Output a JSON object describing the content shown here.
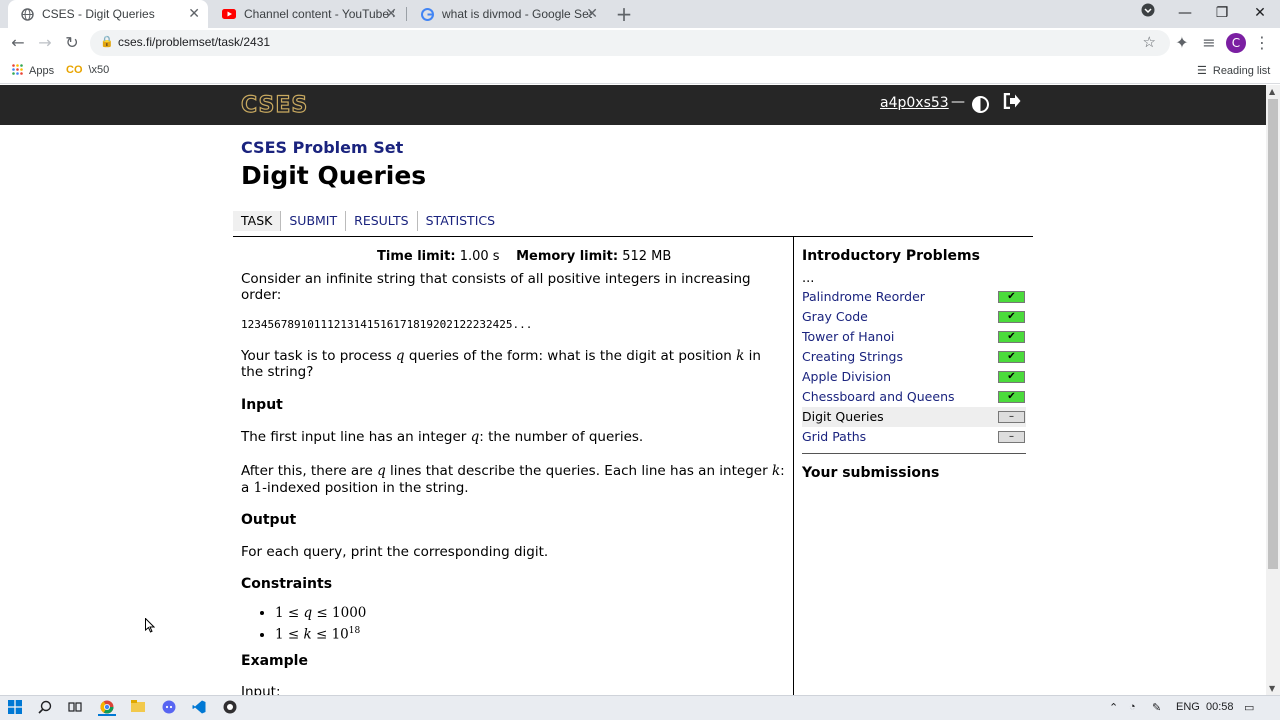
{
  "browser": {
    "tabs": [
      {
        "title": "CSES - Digit Queries",
        "icon": "cses-favicon"
      },
      {
        "title": "Channel content - YouTube Studio",
        "icon": "youtube-favicon"
      },
      {
        "title": "what is divmod - Google Search",
        "icon": "google-favicon"
      }
    ],
    "url": "cses.fi/problemset/task/2431",
    "avatar_letter": "C",
    "reading_list": "Reading list",
    "bookmarks": [
      {
        "label": "Apps",
        "icon": "apps-grid-icon"
      },
      {
        "label": "\\x50",
        "icon": "bookmark-folder-icon"
      }
    ]
  },
  "header": {
    "logo": "CSES",
    "username": "a4p0xs53",
    "dash": "—"
  },
  "site_title": "CSES Problem Set",
  "page_title": "Digit Queries",
  "nav": [
    "TASK",
    "SUBMIT",
    "RESULTS",
    "STATISTICS"
  ],
  "limits": {
    "time_label": "Time limit:",
    "time_value": "1.00 s",
    "memory_label": "Memory limit:",
    "memory_value": "512 MB"
  },
  "statement": {
    "p1": "Consider an infinite string that consists of all positive integers in increasing order:",
    "sequence": "12345678910111213141516171819202122232425...",
    "p2_a": "Your task is to process ",
    "p2_var1": "q",
    "p2_b": " queries of the form: what is the digit at position ",
    "p2_var2": "k",
    "p2_c": " in the string?",
    "input_heading": "Input",
    "input_p1_a": "The first input line has an integer ",
    "input_p1_var": "q",
    "input_p1_b": ": the number of queries.",
    "input_p2_a": "After this, there are ",
    "input_p2_var1": "q",
    "input_p2_b": " lines that describe the queries. Each line has an integer ",
    "input_p2_var2": "k",
    "input_p2_c": ":",
    "input_p2_d": "a ",
    "input_p2_num": "1",
    "input_p2_e": "-indexed position in the string.",
    "output_heading": "Output",
    "output_p": "For each query, print the corresponding digit.",
    "constraints_heading": "Constraints",
    "c1_lo": "1 ≤ ",
    "c1_var": "q",
    "c1_hi": " ≤ 1000",
    "c2_lo": "1 ≤ ",
    "c2_var": "k",
    "c2_hi": " ≤ 10",
    "c2_exp": "18",
    "example_heading": "Example",
    "example_input": "Input:"
  },
  "sidebar": {
    "title": "Introductory Problems",
    "ellipsis": "...",
    "items": [
      {
        "label": "Palindrome Reorder",
        "status": "solved",
        "mark": "✔"
      },
      {
        "label": "Gray Code",
        "status": "solved",
        "mark": "✔"
      },
      {
        "label": "Tower of Hanoi",
        "status": "solved",
        "mark": "✔"
      },
      {
        "label": "Creating Strings",
        "status": "solved",
        "mark": "✔"
      },
      {
        "label": "Apple Division",
        "status": "solved",
        "mark": "✔"
      },
      {
        "label": "Chessboard and Queens",
        "status": "solved",
        "mark": "✔"
      },
      {
        "label": "Digit Queries",
        "status": "unsolved",
        "mark": "–"
      },
      {
        "label": "Grid Paths",
        "status": "unsolved",
        "mark": "–"
      }
    ],
    "submissions_heading": "Your submissions"
  },
  "taskbar": {
    "lang": "ENG",
    "time": "00:58"
  }
}
